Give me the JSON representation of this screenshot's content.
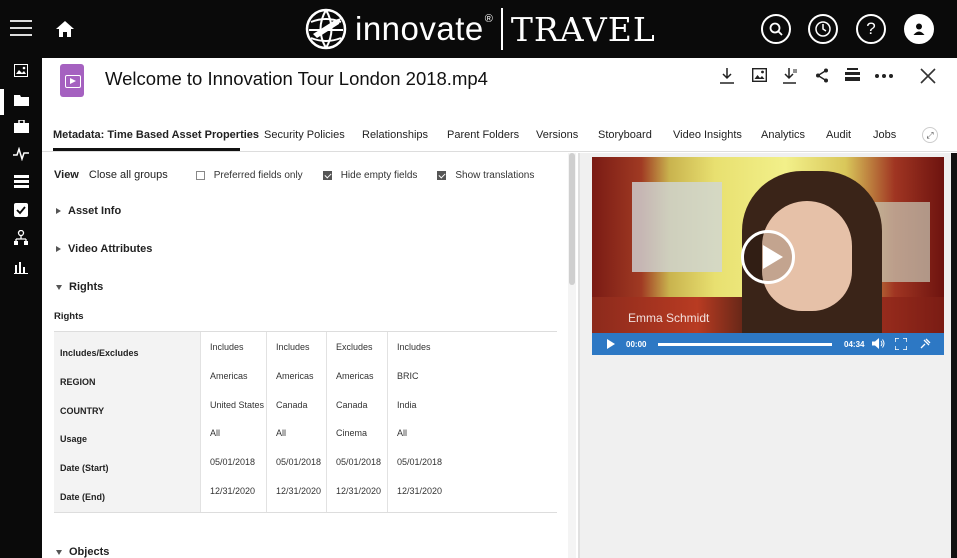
{
  "brand": {
    "name": "innovate",
    "reg": "®",
    "product": "TRAVEL"
  },
  "topbar_icons": [
    "search-icon",
    "history-icon",
    "help-icon",
    "user-icon"
  ],
  "help_glyph": "?",
  "asset": {
    "title": "Welcome to Innovation Tour London 2018.mp4"
  },
  "tabs": [
    "Metadata: Time Based Asset Properties",
    "Security Policies",
    "Relationships",
    "Parent Folders",
    "Versions",
    "Storyboard",
    "Video Insights",
    "Analytics",
    "Audit",
    "Jobs"
  ],
  "view": {
    "label": "View",
    "close_all": "Close all groups",
    "preferred_only": {
      "label": "Preferred fields only",
      "checked": false
    },
    "hide_empty": {
      "label": "Hide empty fields",
      "checked": true
    },
    "show_translations": {
      "label": "Show translations",
      "checked": true
    }
  },
  "groups": {
    "asset_info": "Asset Info",
    "video_attributes": "Video Attributes",
    "rights": "Rights",
    "objects": "Objects"
  },
  "rights_table": {
    "title": "Rights",
    "headers": [
      "Includes/Excludes",
      "REGION",
      "COUNTRY",
      "Usage",
      "Date (Start)",
      "Date (End)"
    ],
    "columns": [
      [
        "Includes",
        "Americas",
        "United States",
        "All",
        "05/01/2018",
        "12/31/2020"
      ],
      [
        "Includes",
        "Americas",
        "Canada",
        "All",
        "05/01/2018",
        "12/31/2020"
      ],
      [
        "Excludes",
        "Americas",
        "Canada",
        "Cinema",
        "05/01/2018",
        "12/31/2020"
      ],
      [
        "Includes",
        "BRIC",
        "India",
        "All",
        "05/01/2018",
        "12/31/2020"
      ]
    ]
  },
  "video": {
    "overlay_name": "Emma Schmidt",
    "current_time": "00:00",
    "duration": "04:34",
    "progress": 0
  },
  "colors": {
    "topbar": "#0a0a0a",
    "file_icon": "#a561c0",
    "player_controls": "#2d78c4"
  }
}
